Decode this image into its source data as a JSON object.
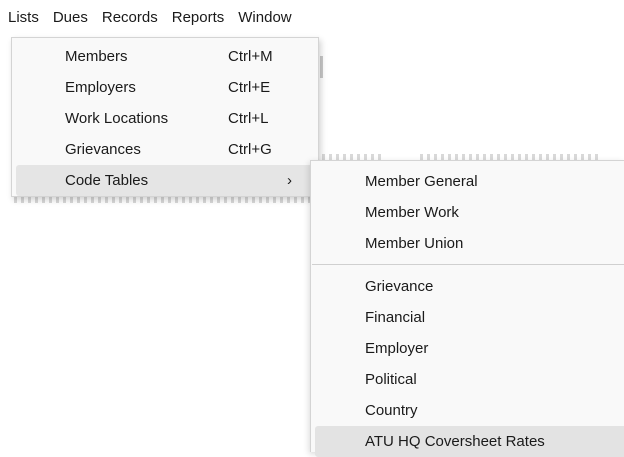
{
  "menubar": {
    "items": [
      "Lists",
      "Dues",
      "Records",
      "Reports",
      "Window"
    ]
  },
  "lists_menu": {
    "items": [
      {
        "label": "Members",
        "shortcut": "Ctrl+M"
      },
      {
        "label": "Employers",
        "shortcut": "Ctrl+E"
      },
      {
        "label": "Work Locations",
        "shortcut": "Ctrl+L"
      },
      {
        "label": "Grievances",
        "shortcut": "Ctrl+G"
      },
      {
        "label": "Code Tables",
        "submenu_indicator": "›"
      }
    ]
  },
  "code_tables_submenu": {
    "group1": [
      "Member General",
      "Member Work",
      "Member Union"
    ],
    "group2": [
      "Grievance",
      "Financial",
      "Employer",
      "Political",
      "Country",
      "ATU HQ Coversheet Rates"
    ]
  },
  "colors": {
    "menu_background": "#f9f9f9",
    "hover_background": "#e5e5e5",
    "border": "#d4d4d4"
  }
}
